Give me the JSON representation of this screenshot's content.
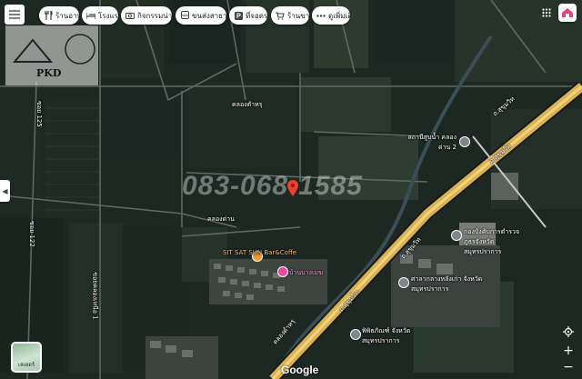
{
  "search_chips": [
    {
      "icon": "fork-knife-icon",
      "label": "ร้านอาหาร"
    },
    {
      "icon": "bed-icon",
      "label": "โรงแรม"
    },
    {
      "icon": "camera-icon",
      "label": "กิจกรรมน่าสนใจ"
    },
    {
      "icon": "bus-icon",
      "label": "ขนส่งสาธารณะ"
    },
    {
      "icon": "parking-icon",
      "label": "ที่จอดรถ"
    },
    {
      "icon": "cart-icon",
      "label": "ร้านขายยา"
    },
    {
      "icon": "more-icon",
      "label": "ดูเพิ่มเติม"
    }
  ],
  "map": {
    "watermark_phone": "083-068-1585",
    "agent_logo_text": "PKD",
    "places": [
      {
        "name": "SIT SAT SUN Bar&Coffe",
        "type": "cafe"
      },
      {
        "name": "บ้านบางเมฆ",
        "type": "shopping"
      },
      {
        "name": "สถานีสูบน้ำ คลองด่าน 2",
        "type": "landmark"
      },
      {
        "name": "กองบังคับการตำรวจ ภูธรจังหวัดสมุทรปราการ",
        "type": "government"
      },
      {
        "name": "ศาลากลางหลังเก่า จังหวัดสมุทรปราการ",
        "type": "government"
      },
      {
        "name": "พิพิธภัณฑ์ จังหวัดสมุทรปราการ",
        "type": "museum"
      }
    ],
    "road_labels": [
      "ถ.สุขุมวิท",
      "ถ.สุขุมวิท",
      "ถ.สุขุมวิท",
      "ถ.สุขุมวิท",
      "คลองตำหรุ",
      "คลองด่าน",
      "คลองตำหรุ",
      "ซอย 122",
      "ซอย 125",
      "ซอยคลองเหนือ 1"
    ],
    "layers_label": "เลเยอร์",
    "google_logo": "Google"
  },
  "colors": {
    "pin": "#ea4335",
    "poi_orange": "#f29b34",
    "poi_pink": "#e44ca4",
    "poi_gray": "#80868b",
    "highway": "#e9c46a"
  }
}
